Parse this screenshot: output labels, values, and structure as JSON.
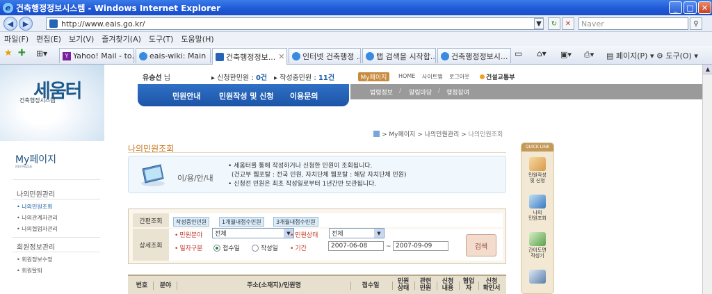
{
  "window": {
    "title": "건축행정정보시스템 - Windows Internet Explorer"
  },
  "browser": {
    "url": "http://www.eais.go.kr/",
    "search_placeholder": "Naver",
    "menu": [
      "파일(F)",
      "편집(E)",
      "보기(V)",
      "즐겨찾기(A)",
      "도구(T)",
      "도움말(H)"
    ],
    "tabs": [
      "Yahoo! Mail - to...",
      "eais-wiki: Main",
      "건축행정정보...",
      "인터넷 건축행정 ...",
      "탭 검색을 시작합...",
      "건축행정정보시..."
    ],
    "commands": {
      "page": "페이지(P)",
      "tools": "도구(O)"
    }
  },
  "site": {
    "logo": "세움터",
    "logo_sub": "건축행정시스템",
    "user_name": "유승선",
    "user_suffix": "님",
    "applied_label": "신청한민원 :",
    "applied_count": "0건",
    "writing_label": "작성중민원 :",
    "writing_count": "11건",
    "mypage_btn": "My페이지",
    "toplinks": [
      "HOME",
      "사이트맵",
      "로그아웃"
    ],
    "ministry": "건설교통부",
    "main_nav": [
      "민원안내",
      "민원작성 및 신청",
      "이용문의"
    ],
    "sub_nav": [
      "법령정보",
      "알림마당",
      "행정참여"
    ]
  },
  "sidebar": {
    "title": "My페이지",
    "subtitle": "MYPAGE",
    "section1": "나의민원관리",
    "section1_items": [
      "나의민원조회",
      "나의관계자관리",
      "나의협업자관리"
    ],
    "section2": "회원정보관리",
    "section2_items": [
      "회원정보수정",
      "회원탈퇴"
    ]
  },
  "main": {
    "breadcrumb": [
      "My페이지",
      "나의민원관리",
      "나의민원조회"
    ],
    "title": "나의민원조회",
    "info_label": "이/용/안/내",
    "info_lines": [
      "• 세움터를 통해 작성하거나 신청한 민원이 조회됩니다.",
      "(건교부 웹포탈 : 전국 민원, 자치단체 웹포탈 : 해당 자치단체 민원)",
      "• 신청전 민원은 최초 작성일로부터 1년간만 보관됩니다."
    ]
  },
  "search": {
    "quick_label": "간편조회",
    "quick_buttons": [
      "작성중인민원",
      "1개월내접수민원",
      "3개월내접수민원"
    ],
    "detail_label": "상세조회",
    "field_type": "민원분야",
    "field_type_value": "전체",
    "field_status": "민원상태",
    "field_status_value": "전체",
    "field_datetype": "일자구분",
    "radio1": "접수일",
    "radio2": "작성일",
    "field_period": "기간",
    "date_from": "2007-06-08",
    "date_sep": "~",
    "date_to": "2007-09-09",
    "search_btn": "검색"
  },
  "table": {
    "headers": [
      "번호",
      "분야",
      "주소(소재지)/민원명",
      "접수일",
      "민원\n상태",
      "관련\n민원",
      "신청\n내용",
      "협업\n자",
      "신청\n확인서"
    ]
  },
  "quicklink": {
    "header": "QUICK LINK",
    "items": [
      "민원작성\n및 신청",
      "나의\n민원조회",
      "간이도면\n작성기"
    ]
  }
}
